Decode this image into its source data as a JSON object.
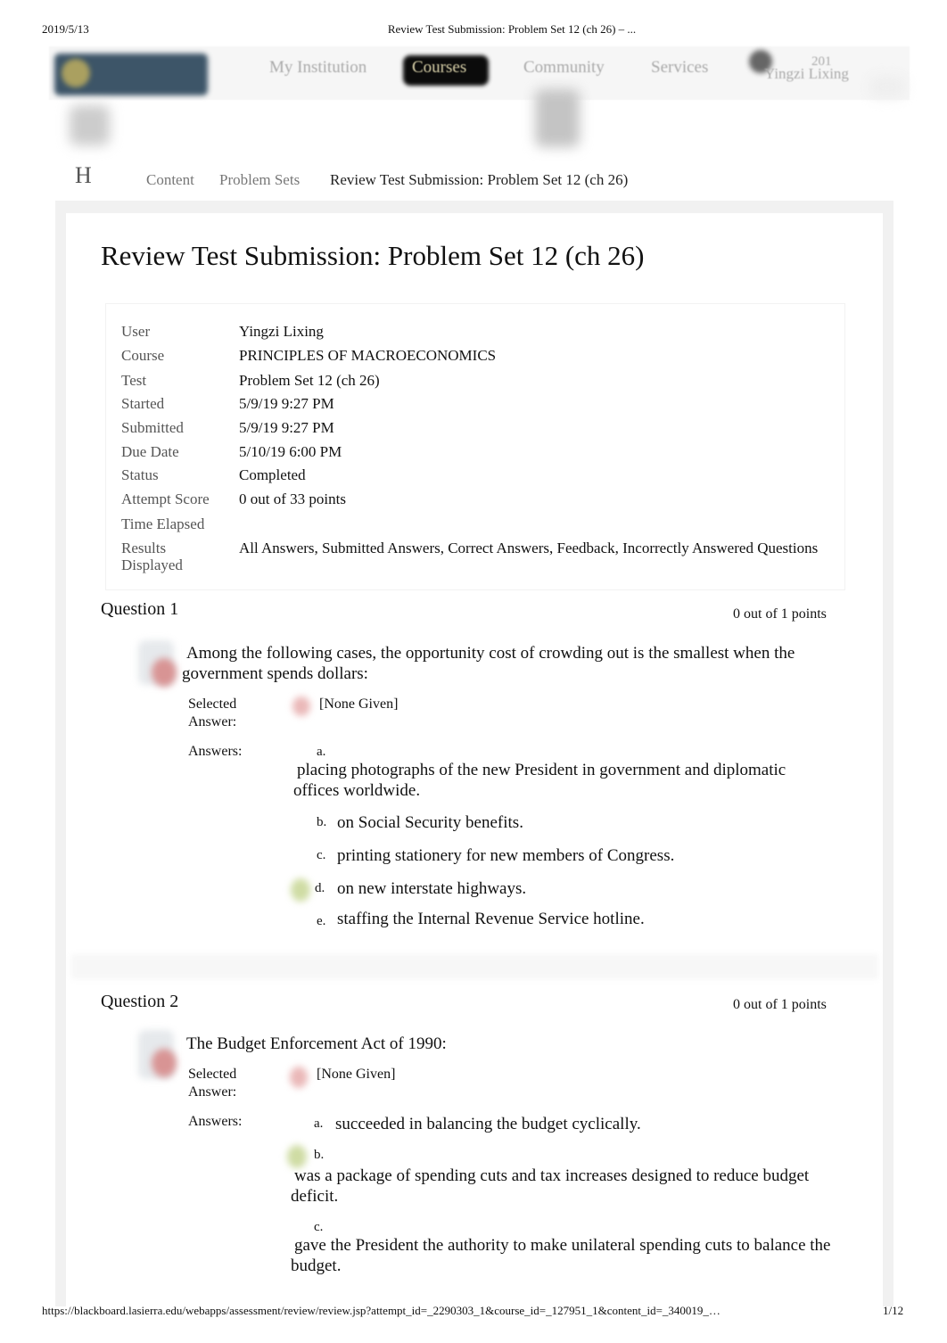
{
  "print_header": {
    "date": "2019/5/13",
    "title": "Review Test Submission: Problem Set 12 (ch 26) – ..."
  },
  "print_footer": {
    "url": "https://blackboard.lasierra.edu/webapps/assessment/review/review.jsp?attempt_id=_2290303_1&course_id=_127951_1&content_id=_340019_…",
    "page": "1/12"
  },
  "nav": {
    "items": [
      "My Institution",
      "Courses",
      "Community",
      "Services"
    ],
    "active": "Courses",
    "user_count": "201",
    "user_name": "Yingzi Lixing"
  },
  "breadcrumb": {
    "home_initial": "H",
    "items": [
      "Content",
      "Problem Sets",
      "Review Test Submission: Problem Set 12 (ch 26)"
    ]
  },
  "page_title": "Review Test Submission: Problem Set 12 (ch 26)",
  "info": [
    {
      "label": "User",
      "value": "Yingzi Lixing"
    },
    {
      "label": "Course",
      "value": "PRINCIPLES OF MACROECONOMICS"
    },
    {
      "label": "Test",
      "value": "Problem Set 12 (ch 26)"
    },
    {
      "label": "Started",
      "value": "5/9/19 9:27 PM"
    },
    {
      "label": "Submitted",
      "value": "5/9/19 9:27 PM"
    },
    {
      "label": "Due Date",
      "value": "5/10/19 6:00 PM"
    },
    {
      "label": "Status",
      "value": "Completed"
    },
    {
      "label": "Attempt Score",
      "value": "0 out of 33 points"
    },
    {
      "label": "Time Elapsed",
      "value": ""
    },
    {
      "label": "Results Displayed",
      "value": "All Answers, Submitted Answers, Correct Answers, Feedback, Incorrectly Answered Questions"
    }
  ],
  "labels": {
    "selected_answer": "Selected Answer:",
    "answers": "Answers:"
  },
  "questions": [
    {
      "title": "Question 1",
      "points": "0 out of 1 points",
      "text": "Among the following cases, the opportunity cost of crowding out is the smallest when the government spends dollars:",
      "selected": "[None Given]",
      "answers": [
        {
          "letter": "a.",
          "text": "placing photographs of the new President in government and diplomatic offices worldwide."
        },
        {
          "letter": "b.",
          "text": "on Social Security benefits."
        },
        {
          "letter": "c.",
          "text": "printing stationery for new members of Congress."
        },
        {
          "letter": "d.",
          "text": "on new interstate highways.",
          "correct": true
        },
        {
          "letter": "e.",
          "text": "staffing the Internal Revenue Service hotline."
        }
      ]
    },
    {
      "title": "Question 2",
      "points": "0 out of 1 points",
      "text": "The Budget Enforcement Act of 1990:",
      "selected": "[None Given]",
      "answers": [
        {
          "letter": "a.",
          "text": "succeeded in balancing the budget cyclically."
        },
        {
          "letter": "b.",
          "text": "was a package of spending cuts and tax increases designed to reduce budget deficit.",
          "correct": true
        },
        {
          "letter": "c.",
          "text": "gave the President the authority to make unilateral spending cuts to balance the budget."
        }
      ]
    }
  ]
}
